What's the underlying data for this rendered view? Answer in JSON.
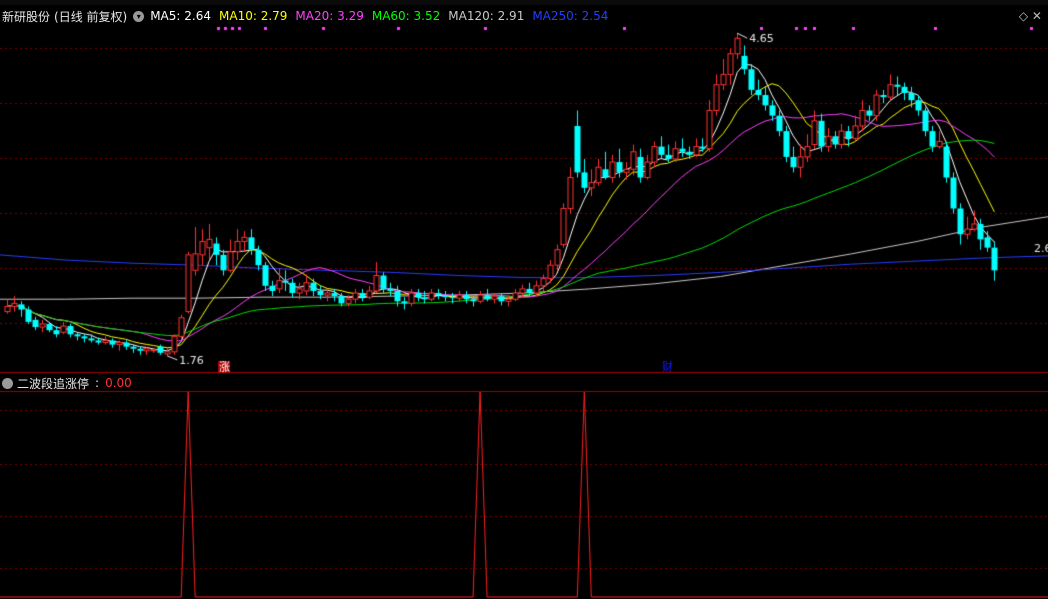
{
  "header": {
    "stock_name": "新研股份",
    "period": "(日线 前复权)",
    "toggle_icon": "chevron-down-icon",
    "ma": [
      {
        "label": "MA5:",
        "value": "2.64",
        "color": "#ffffff"
      },
      {
        "label": "MA10:",
        "value": "2.79",
        "color": "#ffff00"
      },
      {
        "label": "MA20:",
        "value": "3.29",
        "color": "#ff40ff"
      },
      {
        "label": "MA60:",
        "value": "3.52",
        "color": "#00ff00"
      },
      {
        "label": "MA120:",
        "value": "2.91",
        "color": "#c8c8c8"
      },
      {
        "label": "MA250:",
        "value": "2.54",
        "color": "#2040ff"
      }
    ],
    "right_icon": "diamond-icon"
  },
  "indicator": {
    "name": "二波段追涨停",
    "separator": ":",
    "value": "0.00"
  },
  "markers": {
    "rise_label": "涨",
    "finance_label": "财"
  },
  "chart_data": {
    "type": "candlestick",
    "price_range": [
      1.55,
      4.75
    ],
    "high_label": "4.65",
    "low_label": "1.76",
    "right_edge_label": "2.6",
    "colors": {
      "up": "#ff3232",
      "down": "#00ffff",
      "grid": "#7a0000"
    },
    "candles": [
      [
        2.0,
        2.05,
        2.12,
        1.98
      ],
      [
        2.05,
        2.08,
        2.15,
        2.0
      ],
      [
        2.07,
        2.02,
        2.1,
        1.95
      ],
      [
        2.02,
        1.9,
        2.05,
        1.88
      ],
      [
        1.92,
        1.85,
        1.95,
        1.82
      ],
      [
        1.85,
        1.88,
        1.92,
        1.8
      ],
      [
        1.88,
        1.82,
        1.9,
        1.8
      ],
      [
        1.82,
        1.78,
        1.86,
        1.75
      ],
      [
        1.8,
        1.86,
        1.9,
        1.78
      ],
      [
        1.86,
        1.78,
        1.88,
        1.75
      ],
      [
        1.78,
        1.76,
        1.8,
        1.72
      ],
      [
        1.76,
        1.74,
        1.78,
        1.7
      ],
      [
        1.74,
        1.72,
        1.78,
        1.7
      ],
      [
        1.72,
        1.7,
        1.75,
        1.68
      ],
      [
        1.7,
        1.72,
        1.76,
        1.68
      ],
      [
        1.72,
        1.68,
        1.74,
        1.65
      ],
      [
        1.68,
        1.7,
        1.72,
        1.62
      ],
      [
        1.7,
        1.66,
        1.72,
        1.63
      ],
      [
        1.66,
        1.64,
        1.68,
        1.6
      ],
      [
        1.64,
        1.62,
        1.66,
        1.58
      ],
      [
        1.62,
        1.64,
        1.66,
        1.58
      ],
      [
        1.62,
        1.63,
        1.65,
        1.6
      ],
      [
        1.66,
        1.6,
        1.68,
        1.58
      ],
      [
        1.59,
        1.61,
        1.65,
        1.57
      ],
      [
        1.61,
        1.76,
        1.78,
        1.58
      ],
      [
        1.76,
        1.94,
        1.97,
        1.73
      ],
      [
        2.0,
        2.55,
        2.58,
        1.98
      ],
      [
        2.4,
        2.56,
        2.82,
        2.35
      ],
      [
        2.55,
        2.68,
        2.8,
        2.45
      ],
      [
        2.62,
        2.7,
        2.85,
        2.5
      ],
      [
        2.66,
        2.55,
        2.72,
        2.45
      ],
      [
        2.55,
        2.4,
        2.6,
        2.35
      ],
      [
        2.4,
        2.58,
        2.7,
        2.38
      ],
      [
        2.58,
        2.68,
        2.8,
        2.5
      ],
      [
        2.68,
        2.72,
        2.78,
        2.58
      ],
      [
        2.72,
        2.6,
        2.8,
        2.55
      ],
      [
        2.6,
        2.45,
        2.64,
        2.4
      ],
      [
        2.45,
        2.25,
        2.48,
        2.2
      ],
      [
        2.25,
        2.2,
        2.3,
        2.15
      ],
      [
        2.22,
        2.3,
        2.42,
        2.18
      ],
      [
        2.3,
        2.28,
        2.4,
        2.2
      ],
      [
        2.28,
        2.18,
        2.32,
        2.14
      ],
      [
        2.18,
        2.22,
        2.28,
        2.12
      ],
      [
        2.2,
        2.28,
        2.36,
        2.16
      ],
      [
        2.28,
        2.2,
        2.32,
        2.15
      ],
      [
        2.2,
        2.16,
        2.25,
        2.12
      ],
      [
        2.16,
        2.18,
        2.22,
        2.1
      ],
      [
        2.18,
        2.15,
        2.22,
        2.1
      ],
      [
        2.15,
        2.08,
        2.18,
        2.05
      ],
      [
        2.08,
        2.12,
        2.16,
        2.05
      ],
      [
        2.12,
        2.18,
        2.22,
        2.08
      ],
      [
        2.18,
        2.14,
        2.22,
        2.1
      ],
      [
        2.14,
        2.2,
        2.25,
        2.12
      ],
      [
        2.2,
        2.35,
        2.48,
        2.18
      ],
      [
        2.35,
        2.22,
        2.38,
        2.18
      ],
      [
        2.22,
        2.2,
        2.28,
        2.15
      ],
      [
        2.2,
        2.1,
        2.25,
        2.05
      ],
      [
        2.1,
        2.08,
        2.14,
        2.02
      ],
      [
        2.08,
        2.18,
        2.22,
        2.05
      ],
      [
        2.18,
        2.14,
        2.22,
        2.1
      ],
      [
        2.14,
        2.12,
        2.2,
        2.08
      ],
      [
        2.12,
        2.18,
        2.22,
        2.1
      ],
      [
        2.18,
        2.16,
        2.22,
        2.12
      ],
      [
        2.16,
        2.14,
        2.2,
        2.1
      ],
      [
        2.14,
        2.13,
        2.18,
        2.08
      ],
      [
        2.13,
        2.16,
        2.2,
        2.1
      ],
      [
        2.16,
        2.12,
        2.2,
        2.08
      ],
      [
        2.12,
        2.1,
        2.15,
        2.05
      ],
      [
        2.1,
        2.16,
        2.2,
        2.08
      ],
      [
        2.16,
        2.12,
        2.22,
        2.1
      ],
      [
        2.12,
        2.15,
        2.18,
        2.08
      ],
      [
        2.15,
        2.1,
        2.18,
        2.06
      ],
      [
        2.1,
        2.12,
        2.16,
        2.05
      ],
      [
        2.12,
        2.18,
        2.22,
        2.1
      ],
      [
        2.18,
        2.22,
        2.26,
        2.14
      ],
      [
        2.22,
        2.18,
        2.28,
        2.15
      ],
      [
        2.18,
        2.25,
        2.3,
        2.15
      ],
      [
        2.25,
        2.32,
        2.36,
        2.2
      ],
      [
        2.32,
        2.45,
        2.5,
        2.28
      ],
      [
        2.45,
        2.6,
        2.65,
        2.4
      ],
      [
        2.65,
        3.0,
        3.05,
        2.62
      ],
      [
        3.0,
        3.3,
        3.4,
        2.95
      ],
      [
        3.8,
        3.35,
        3.95,
        3.3
      ],
      [
        3.35,
        3.2,
        3.48,
        3.15
      ],
      [
        3.2,
        3.25,
        3.38,
        3.12
      ],
      [
        3.25,
        3.4,
        3.48,
        3.22
      ],
      [
        3.38,
        3.3,
        3.55,
        3.28
      ],
      [
        3.3,
        3.45,
        3.52,
        3.25
      ],
      [
        3.45,
        3.35,
        3.58,
        3.3
      ],
      [
        3.35,
        3.38,
        3.45,
        3.28
      ],
      [
        3.38,
        3.55,
        3.62,
        3.32
      ],
      [
        3.5,
        3.3,
        3.58,
        3.25
      ],
      [
        3.3,
        3.45,
        3.52,
        3.28
      ],
      [
        3.45,
        3.6,
        3.65,
        3.4
      ],
      [
        3.6,
        3.52,
        3.7,
        3.48
      ],
      [
        3.52,
        3.48,
        3.62,
        3.45
      ],
      [
        3.48,
        3.58,
        3.65,
        3.45
      ],
      [
        3.58,
        3.55,
        3.68,
        3.5
      ],
      [
        3.55,
        3.52,
        3.6,
        3.48
      ],
      [
        3.52,
        3.6,
        3.68,
        3.5
      ],
      [
        3.6,
        3.58,
        3.68,
        3.55
      ],
      [
        3.58,
        3.95,
        4.05,
        3.55
      ],
      [
        3.95,
        4.2,
        4.3,
        3.9
      ],
      [
        4.2,
        4.3,
        4.45,
        4.15
      ],
      [
        4.3,
        4.5,
        4.55,
        4.2
      ],
      [
        4.5,
        4.65,
        4.7,
        4.45
      ],
      [
        4.48,
        4.35,
        4.58,
        4.3
      ],
      [
        4.35,
        4.15,
        4.4,
        4.1
      ],
      [
        4.15,
        4.1,
        4.25,
        4.05
      ],
      [
        4.1,
        4.0,
        4.18,
        3.95
      ],
      [
        4.0,
        3.9,
        4.05,
        3.85
      ],
      [
        3.9,
        3.75,
        3.95,
        3.7
      ],
      [
        3.75,
        3.5,
        3.8,
        3.45
      ],
      [
        3.5,
        3.4,
        3.6,
        3.35
      ],
      [
        3.4,
        3.5,
        3.62,
        3.3
      ],
      [
        3.5,
        3.6,
        3.72,
        3.45
      ],
      [
        3.62,
        3.85,
        3.95,
        3.58
      ],
      [
        3.85,
        3.6,
        3.92,
        3.55
      ],
      [
        3.6,
        3.7,
        3.78,
        3.55
      ],
      [
        3.7,
        3.62,
        3.75,
        3.58
      ],
      [
        3.62,
        3.75,
        3.82,
        3.58
      ],
      [
        3.75,
        3.68,
        3.8,
        3.6
      ],
      [
        3.68,
        3.8,
        3.9,
        3.65
      ],
      [
        3.8,
        3.95,
        4.05,
        3.75
      ],
      [
        3.95,
        3.9,
        4.0,
        3.85
      ],
      [
        3.9,
        4.1,
        4.15,
        3.85
      ],
      [
        4.1,
        4.08,
        4.15,
        4.02
      ],
      [
        4.08,
        4.2,
        4.3,
        4.05
      ],
      [
        4.2,
        4.18,
        4.28,
        4.1
      ],
      [
        4.18,
        4.12,
        4.22,
        4.05
      ],
      [
        4.12,
        4.05,
        4.18,
        3.98
      ],
      [
        4.05,
        3.95,
        4.1,
        3.9
      ],
      [
        3.95,
        3.75,
        3.98,
        3.7
      ],
      [
        3.75,
        3.6,
        3.8,
        3.55
      ],
      [
        3.6,
        3.65,
        3.75,
        3.58
      ],
      [
        3.6,
        3.3,
        3.65,
        3.25
      ],
      [
        3.3,
        3.0,
        3.35,
        2.95
      ],
      [
        3.0,
        2.75,
        3.05,
        2.65
      ],
      [
        2.75,
        2.8,
        2.92,
        2.7
      ],
      [
        2.8,
        2.85,
        2.98,
        2.78
      ],
      [
        2.85,
        2.7,
        2.9,
        2.6
      ],
      [
        2.72,
        2.62,
        2.78,
        2.58
      ],
      [
        2.62,
        2.4,
        2.68,
        2.3
      ]
    ],
    "ma_series": [
      {
        "name": "MA5",
        "color": "#ffffff",
        "period": 5
      },
      {
        "name": "MA10",
        "color": "#ffff00",
        "period": 10
      },
      {
        "name": "MA20",
        "color": "#ff40ff",
        "period": 20
      },
      {
        "name": "MA60",
        "color": "#00dd00",
        "period": 60
      }
    ],
    "long_ma": [
      {
        "name": "MA120",
        "color": "#c8c8c8",
        "values": [
          2.12,
          2.12,
          2.13,
          2.13,
          2.14,
          2.14,
          2.15,
          2.16,
          2.18,
          2.22,
          2.27,
          2.34,
          2.45,
          2.56,
          2.68,
          2.82,
          2.92
        ]
      },
      {
        "name": "MA250",
        "color": "#2a3cff",
        "values": [
          2.55,
          2.5,
          2.47,
          2.45,
          2.42,
          2.4,
          2.38,
          2.35,
          2.33,
          2.33,
          2.35,
          2.38,
          2.42,
          2.46,
          2.49,
          2.52,
          2.54
        ]
      }
    ],
    "indicator_spikes": [
      26,
      68,
      83
    ],
    "indicator_range": [
      0,
      1
    ]
  }
}
